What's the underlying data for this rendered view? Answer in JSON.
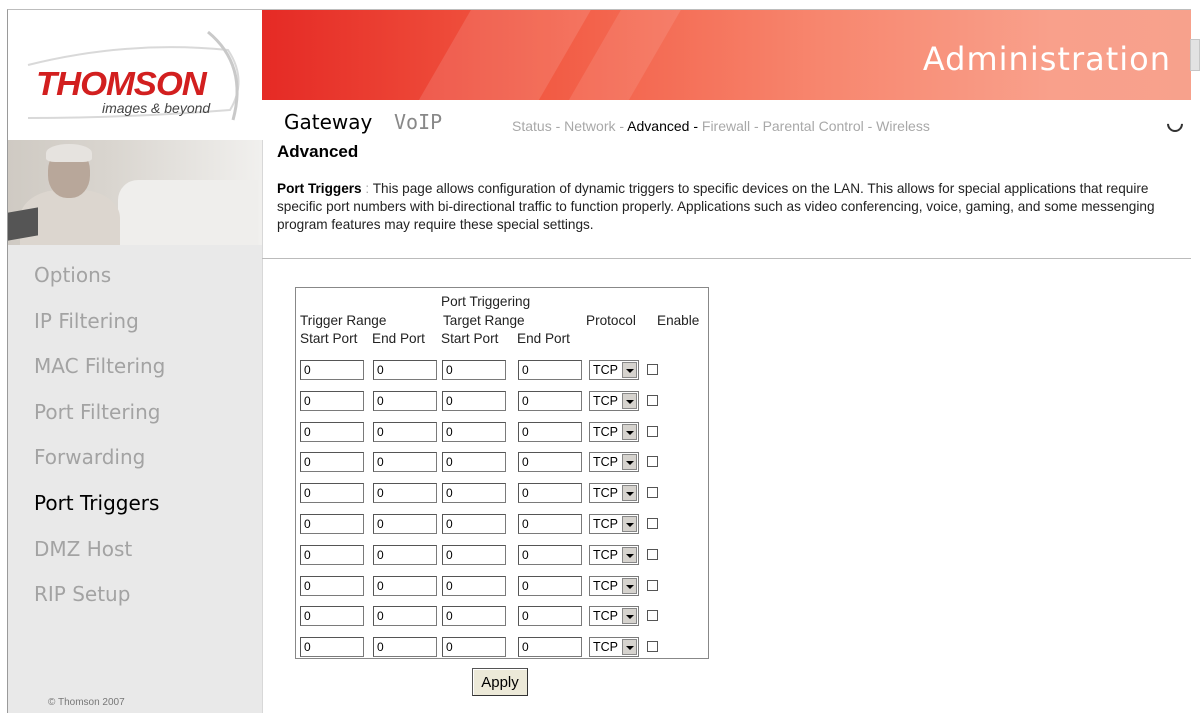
{
  "header": {
    "logo_text": "THOMSON",
    "tagline": "images & beyond",
    "banner_title": "Administration"
  },
  "nav": {
    "primary": [
      "Gateway",
      "VoIP"
    ],
    "secondary": [
      {
        "label": "Status -",
        "active": false
      },
      {
        "label": "Network -",
        "active": false
      },
      {
        "label": "Advanced -",
        "active": true
      },
      {
        "label": "Firewall -",
        "active": false
      },
      {
        "label": "Parental Control -",
        "active": false
      },
      {
        "label": "Wireless",
        "active": false
      }
    ]
  },
  "sidebar": {
    "items": [
      {
        "label": "Options",
        "active": false
      },
      {
        "label": "IP Filtering",
        "active": false
      },
      {
        "label": "MAC Filtering",
        "active": false
      },
      {
        "label": "Port Filtering",
        "active": false
      },
      {
        "label": "Forwarding",
        "active": false
      },
      {
        "label": "Port Triggers",
        "active": true
      },
      {
        "label": "DMZ Host",
        "active": false
      },
      {
        "label": "RIP Setup",
        "active": false
      }
    ],
    "footer": "© Thomson 2007"
  },
  "main": {
    "title": "Advanced",
    "description_label": "Port Triggers",
    "description_sep": ":",
    "description_text": "This page allows configuration of dynamic triggers to specific devices on the LAN. This allows for special applications that require specific port numbers with bi-directional traffic to function properly. Applications such as video conferencing, voice, gaming, and some messenging program features may require these special settings."
  },
  "triggers": {
    "caption": "Port Triggering",
    "trigger_range": "Trigger Range",
    "target_range": "Target Range",
    "protocol": "Protocol",
    "enable": "Enable",
    "start_port": "Start Port",
    "end_port": "End Port",
    "target_start_port": "Start Port",
    "target_end_port": "End Port",
    "rows": [
      {
        "trigger_start": "0",
        "trigger_end": "0",
        "target_start": "0",
        "target_end": "0",
        "protocol": "TCP",
        "enabled": false
      },
      {
        "trigger_start": "0",
        "trigger_end": "0",
        "target_start": "0",
        "target_end": "0",
        "protocol": "TCP",
        "enabled": false
      },
      {
        "trigger_start": "0",
        "trigger_end": "0",
        "target_start": "0",
        "target_end": "0",
        "protocol": "TCP",
        "enabled": false
      },
      {
        "trigger_start": "0",
        "trigger_end": "0",
        "target_start": "0",
        "target_end": "0",
        "protocol": "TCP",
        "enabled": false
      },
      {
        "trigger_start": "0",
        "trigger_end": "0",
        "target_start": "0",
        "target_end": "0",
        "protocol": "TCP",
        "enabled": false
      },
      {
        "trigger_start": "0",
        "trigger_end": "0",
        "target_start": "0",
        "target_end": "0",
        "protocol": "TCP",
        "enabled": false
      },
      {
        "trigger_start": "0",
        "trigger_end": "0",
        "target_start": "0",
        "target_end": "0",
        "protocol": "TCP",
        "enabled": false
      },
      {
        "trigger_start": "0",
        "trigger_end": "0",
        "target_start": "0",
        "target_end": "0",
        "protocol": "TCP",
        "enabled": false
      },
      {
        "trigger_start": "0",
        "trigger_end": "0",
        "target_start": "0",
        "target_end": "0",
        "protocol": "TCP",
        "enabled": false
      },
      {
        "trigger_start": "0",
        "trigger_end": "0",
        "target_start": "0",
        "target_end": "0",
        "protocol": "TCP",
        "enabled": false
      }
    ],
    "apply_label": "Apply"
  }
}
